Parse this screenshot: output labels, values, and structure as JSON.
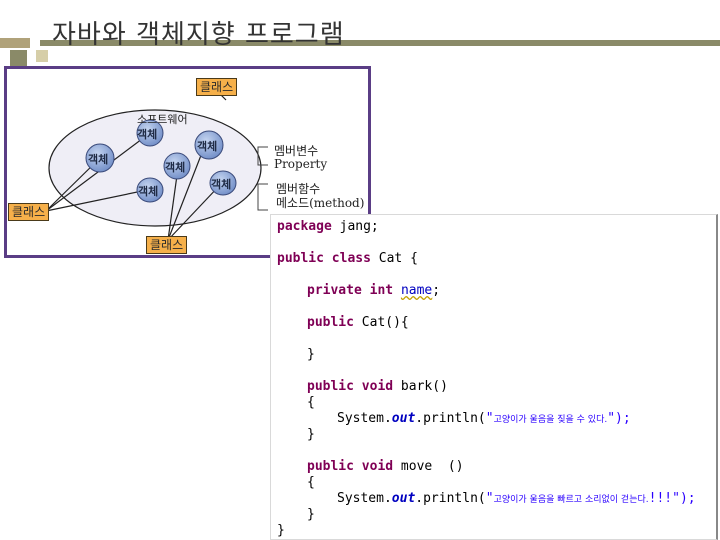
{
  "title": "자바와 객체지향 프로그램",
  "diagram": {
    "class_top": "클래스",
    "software": "소프트웨어",
    "object_label": "객체",
    "class_left": "클래스",
    "class_bottom": "클래스",
    "member_var": "멤버변수",
    "property": "Property",
    "member_func": "멤버함수",
    "method": "메소드(method)"
  },
  "code": {
    "package_kw": "package",
    "package_name": " jang;",
    "public_kw": "public",
    "class_kw": "class",
    "class_name": " Cat {",
    "private_kw": "private",
    "int_kw": "int",
    "field_name": "name",
    "semi": ";",
    "ctor": " Cat(){",
    "close": "}",
    "void_kw": "void",
    "bark": " bark()",
    "open": "{",
    "sys": "System.",
    "out": "out",
    "println": ".println(",
    "str1_q": "\"",
    "str1_ko": "고양이가 울음을 짖을 수 있다.",
    "str1_end": "\");",
    "move": " move  ()",
    "str2_ko": "고양이가 울음을 빠르고 소리없이 걷는다.",
    "str2_end": "!!!\");"
  },
  "colors": {
    "keyword": "#7f0055",
    "field": "#0000c0",
    "string": "#2a00ff",
    "class_label_bg": "#f6b04a",
    "object_fill": "#8aa6d8",
    "ellipse_fill": "#efeef6",
    "frame": "#5a3d85"
  }
}
